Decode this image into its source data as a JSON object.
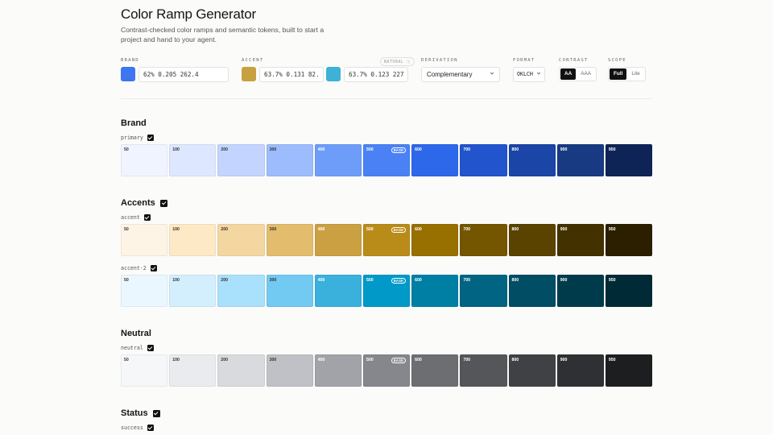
{
  "header": {
    "title": "Color Ramp Generator",
    "subtitle": "Contrast-checked color ramps and semantic tokens, built to start a project and hand to your agent."
  },
  "controls": {
    "brand": {
      "label": "BRAND",
      "value": "62% 0.205 262.4",
      "color": "#3c76f0"
    },
    "accent": {
      "label": "ACCENT",
      "value": "63.7% 0.131 82.4",
      "color": "#c8a040",
      "badge": "NATURAL ⓘ"
    },
    "accent2": {
      "value": "63.7% 0.123 227.7",
      "color": "#3db2d6"
    },
    "derivation": {
      "label": "DERIVATION",
      "value": "Complementary"
    },
    "format": {
      "label": "FORMAT",
      "value": "OKLCH"
    },
    "contrast": {
      "label": "CONTRAST",
      "options": [
        "AA",
        "AAA"
      ],
      "selected": "AA"
    },
    "scope": {
      "label": "SCOPE",
      "options": [
        "Full",
        "Lite"
      ],
      "selected": "Full"
    }
  },
  "base_label": "BASE",
  "steps": [
    "50",
    "100",
    "200",
    "300",
    "400",
    "500",
    "600",
    "700",
    "800",
    "900",
    "950"
  ],
  "sections": [
    {
      "title": "Brand",
      "checked": false,
      "ramps": [
        {
          "name": "primary",
          "colors": [
            "#f0f4ff",
            "#dde7ff",
            "#c3d5ff",
            "#9cbcfd",
            "#6e9df9",
            "#4a82f5",
            "#2d68ea",
            "#2154cd",
            "#1b45a6",
            "#183a82",
            "#0e2356"
          ],
          "text": [
            "#333",
            "#333",
            "#333",
            "#333",
            "#fff",
            "#fff",
            "#fff",
            "#fff",
            "#fff",
            "#fff",
            "#fff"
          ]
        }
      ]
    },
    {
      "title": "Accents",
      "checked": true,
      "ramps": [
        {
          "name": "accent",
          "colors": [
            "#fef4e6",
            "#fde9c5",
            "#f3d6a0",
            "#e3bc6e",
            "#cba042",
            "#b98c19",
            "#977000",
            "#755600",
            "#5a4200",
            "#443100",
            "#2b1f00"
          ],
          "text": [
            "#333",
            "#333",
            "#333",
            "#333",
            "#fff",
            "#fff",
            "#fff",
            "#fff",
            "#fff",
            "#fff",
            "#fff"
          ]
        },
        {
          "name": "accent-2",
          "colors": [
            "#ebf7fe",
            "#d3effd",
            "#a9e0fb",
            "#72c9f1",
            "#3ab0dd",
            "#0099c8",
            "#007fa5",
            "#006482",
            "#004d64",
            "#003b4c",
            "#002a35"
          ],
          "text": [
            "#333",
            "#333",
            "#333",
            "#333",
            "#fff",
            "#fff",
            "#fff",
            "#fff",
            "#fff",
            "#fff",
            "#fff"
          ]
        }
      ]
    },
    {
      "title": "Neutral",
      "checked": false,
      "ramps": [
        {
          "name": "neutral",
          "colors": [
            "#f6f7f9",
            "#eaebee",
            "#d9dade",
            "#bfc1c6",
            "#a1a3a8",
            "#85878c",
            "#6c6e72",
            "#55565a",
            "#404144",
            "#2f3033",
            "#1d1e20"
          ],
          "text": [
            "#333",
            "#333",
            "#333",
            "#333",
            "#fff",
            "#fff",
            "#fff",
            "#fff",
            "#fff",
            "#fff",
            "#fff"
          ]
        }
      ]
    },
    {
      "title": "Status",
      "checked": true,
      "ramps": [
        {
          "name": "success",
          "colors": [],
          "text": []
        }
      ]
    }
  ]
}
